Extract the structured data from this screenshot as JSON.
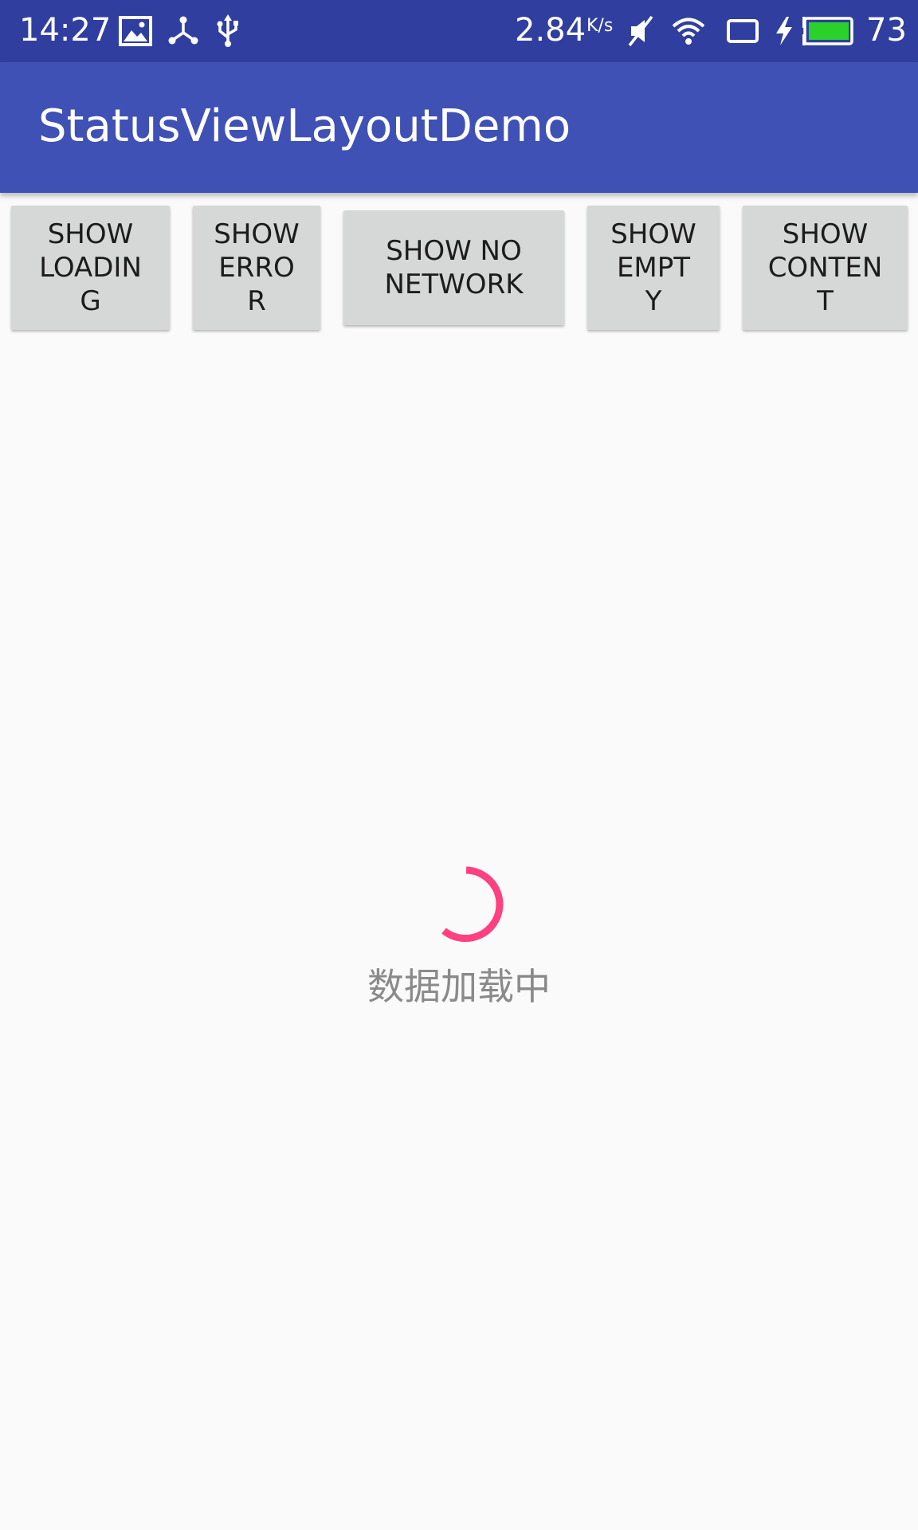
{
  "status_bar": {
    "time": "14:27",
    "net_speed": "2.84",
    "net_speed_unit": "K/s",
    "battery_percent": "73",
    "battery_level": 0.73,
    "battery_color": "#2bd12b",
    "icons": [
      "image-icon",
      "share-icon",
      "usb-icon",
      "mute-icon",
      "wifi-icon",
      "screen-icon",
      "charging-icon",
      "battery-icon"
    ]
  },
  "app_bar": {
    "title": "StatusViewLayoutDemo",
    "color": "#3f51b5",
    "status_color": "#303f9f"
  },
  "buttons": [
    {
      "label": "SHOW\nLOADIN\nG"
    },
    {
      "label": "SHOW\nERRO\nR"
    },
    {
      "label": "SHOW NO\nNETWORK"
    },
    {
      "label": "SHOW\nEMPT\nY"
    },
    {
      "label": "SHOW\nCONTEN\nT"
    }
  ],
  "loading": {
    "text": "数据加载中",
    "spinner_color": "#ff4081"
  }
}
